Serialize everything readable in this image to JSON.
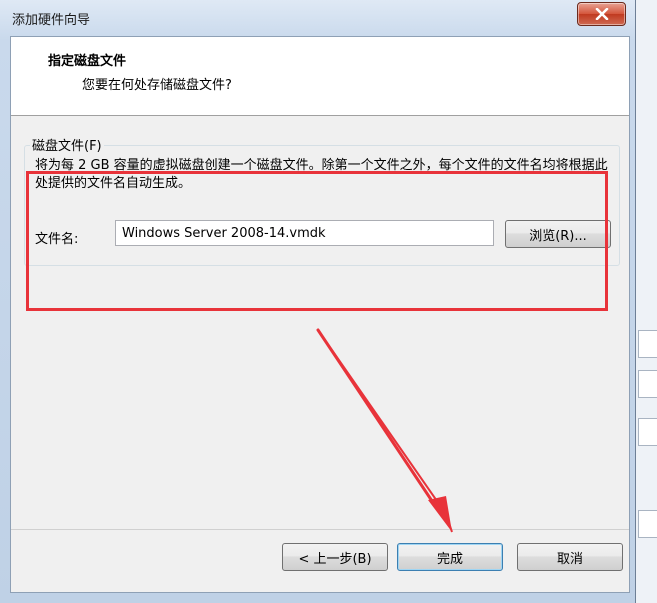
{
  "window": {
    "title": "添加硬件向导",
    "close_glyph": "✕"
  },
  "header": {
    "title": "指定磁盘文件",
    "subtitle": "您要在何处存储磁盘文件?"
  },
  "disk_file_group": {
    "label": "磁盘文件(F)",
    "description": "将为每 2 GB 容量的虚拟磁盘创建一个磁盘文件。除第一个文件之外，每个文件的文件名均将根据此处提供的文件名自动生成。",
    "file_name_label": "文件名:",
    "file_name_value": "Windows Server 2008-14.vmdk",
    "browse_label": "浏览(R)..."
  },
  "buttons": {
    "back_label": "< 上一步(B)",
    "finish_label": "完成",
    "cancel_label": "取消"
  },
  "colors": {
    "annotation": "#e8333a",
    "accent": "#3c7fb1",
    "close_button": "#c03a20"
  },
  "icons": {
    "close": "close-icon"
  }
}
